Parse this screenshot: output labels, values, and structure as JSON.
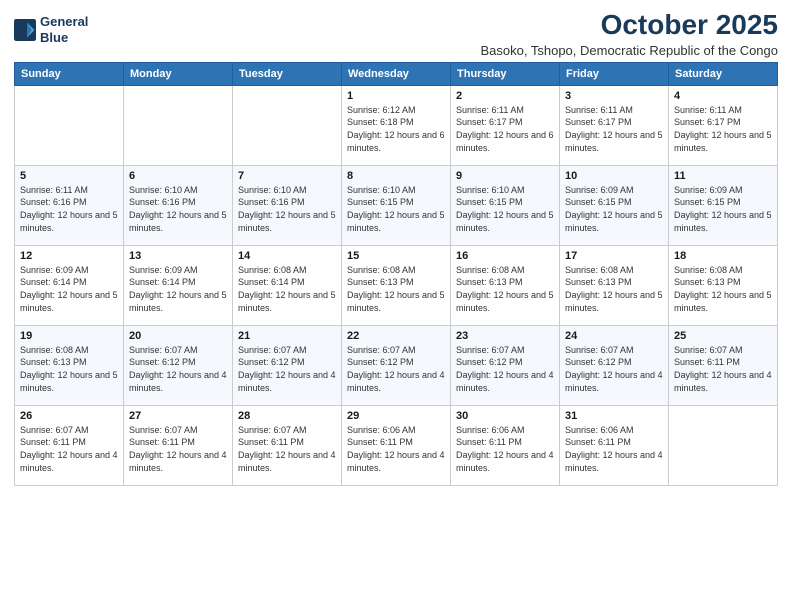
{
  "logo": {
    "line1": "General",
    "line2": "Blue"
  },
  "title": "October 2025",
  "subtitle": "Basoko, Tshopo, Democratic Republic of the Congo",
  "days_of_week": [
    "Sunday",
    "Monday",
    "Tuesday",
    "Wednesday",
    "Thursday",
    "Friday",
    "Saturday"
  ],
  "weeks": [
    [
      {
        "day": "",
        "detail": ""
      },
      {
        "day": "",
        "detail": ""
      },
      {
        "day": "",
        "detail": ""
      },
      {
        "day": "1",
        "detail": "Sunrise: 6:12 AM\nSunset: 6:18 PM\nDaylight: 12 hours\nand 6 minutes."
      },
      {
        "day": "2",
        "detail": "Sunrise: 6:11 AM\nSunset: 6:17 PM\nDaylight: 12 hours\nand 6 minutes."
      },
      {
        "day": "3",
        "detail": "Sunrise: 6:11 AM\nSunset: 6:17 PM\nDaylight: 12 hours\nand 5 minutes."
      },
      {
        "day": "4",
        "detail": "Sunrise: 6:11 AM\nSunset: 6:17 PM\nDaylight: 12 hours\nand 5 minutes."
      }
    ],
    [
      {
        "day": "5",
        "detail": "Sunrise: 6:11 AM\nSunset: 6:16 PM\nDaylight: 12 hours\nand 5 minutes."
      },
      {
        "day": "6",
        "detail": "Sunrise: 6:10 AM\nSunset: 6:16 PM\nDaylight: 12 hours\nand 5 minutes."
      },
      {
        "day": "7",
        "detail": "Sunrise: 6:10 AM\nSunset: 6:16 PM\nDaylight: 12 hours\nand 5 minutes."
      },
      {
        "day": "8",
        "detail": "Sunrise: 6:10 AM\nSunset: 6:15 PM\nDaylight: 12 hours\nand 5 minutes."
      },
      {
        "day": "9",
        "detail": "Sunrise: 6:10 AM\nSunset: 6:15 PM\nDaylight: 12 hours\nand 5 minutes."
      },
      {
        "day": "10",
        "detail": "Sunrise: 6:09 AM\nSunset: 6:15 PM\nDaylight: 12 hours\nand 5 minutes."
      },
      {
        "day": "11",
        "detail": "Sunrise: 6:09 AM\nSunset: 6:15 PM\nDaylight: 12 hours\nand 5 minutes."
      }
    ],
    [
      {
        "day": "12",
        "detail": "Sunrise: 6:09 AM\nSunset: 6:14 PM\nDaylight: 12 hours\nand 5 minutes."
      },
      {
        "day": "13",
        "detail": "Sunrise: 6:09 AM\nSunset: 6:14 PM\nDaylight: 12 hours\nand 5 minutes."
      },
      {
        "day": "14",
        "detail": "Sunrise: 6:08 AM\nSunset: 6:14 PM\nDaylight: 12 hours\nand 5 minutes."
      },
      {
        "day": "15",
        "detail": "Sunrise: 6:08 AM\nSunset: 6:13 PM\nDaylight: 12 hours\nand 5 minutes."
      },
      {
        "day": "16",
        "detail": "Sunrise: 6:08 AM\nSunset: 6:13 PM\nDaylight: 12 hours\nand 5 minutes."
      },
      {
        "day": "17",
        "detail": "Sunrise: 6:08 AM\nSunset: 6:13 PM\nDaylight: 12 hours\nand 5 minutes."
      },
      {
        "day": "18",
        "detail": "Sunrise: 6:08 AM\nSunset: 6:13 PM\nDaylight: 12 hours\nand 5 minutes."
      }
    ],
    [
      {
        "day": "19",
        "detail": "Sunrise: 6:08 AM\nSunset: 6:13 PM\nDaylight: 12 hours\nand 5 minutes."
      },
      {
        "day": "20",
        "detail": "Sunrise: 6:07 AM\nSunset: 6:12 PM\nDaylight: 12 hours\nand 4 minutes."
      },
      {
        "day": "21",
        "detail": "Sunrise: 6:07 AM\nSunset: 6:12 PM\nDaylight: 12 hours\nand 4 minutes."
      },
      {
        "day": "22",
        "detail": "Sunrise: 6:07 AM\nSunset: 6:12 PM\nDaylight: 12 hours\nand 4 minutes."
      },
      {
        "day": "23",
        "detail": "Sunrise: 6:07 AM\nSunset: 6:12 PM\nDaylight: 12 hours\nand 4 minutes."
      },
      {
        "day": "24",
        "detail": "Sunrise: 6:07 AM\nSunset: 6:12 PM\nDaylight: 12 hours\nand 4 minutes."
      },
      {
        "day": "25",
        "detail": "Sunrise: 6:07 AM\nSunset: 6:11 PM\nDaylight: 12 hours\nand 4 minutes."
      }
    ],
    [
      {
        "day": "26",
        "detail": "Sunrise: 6:07 AM\nSunset: 6:11 PM\nDaylight: 12 hours\nand 4 minutes."
      },
      {
        "day": "27",
        "detail": "Sunrise: 6:07 AM\nSunset: 6:11 PM\nDaylight: 12 hours\nand 4 minutes."
      },
      {
        "day": "28",
        "detail": "Sunrise: 6:07 AM\nSunset: 6:11 PM\nDaylight: 12 hours\nand 4 minutes."
      },
      {
        "day": "29",
        "detail": "Sunrise: 6:06 AM\nSunset: 6:11 PM\nDaylight: 12 hours\nand 4 minutes."
      },
      {
        "day": "30",
        "detail": "Sunrise: 6:06 AM\nSunset: 6:11 PM\nDaylight: 12 hours\nand 4 minutes."
      },
      {
        "day": "31",
        "detail": "Sunrise: 6:06 AM\nSunset: 6:11 PM\nDaylight: 12 hours\nand 4 minutes."
      },
      {
        "day": "",
        "detail": ""
      }
    ]
  ]
}
